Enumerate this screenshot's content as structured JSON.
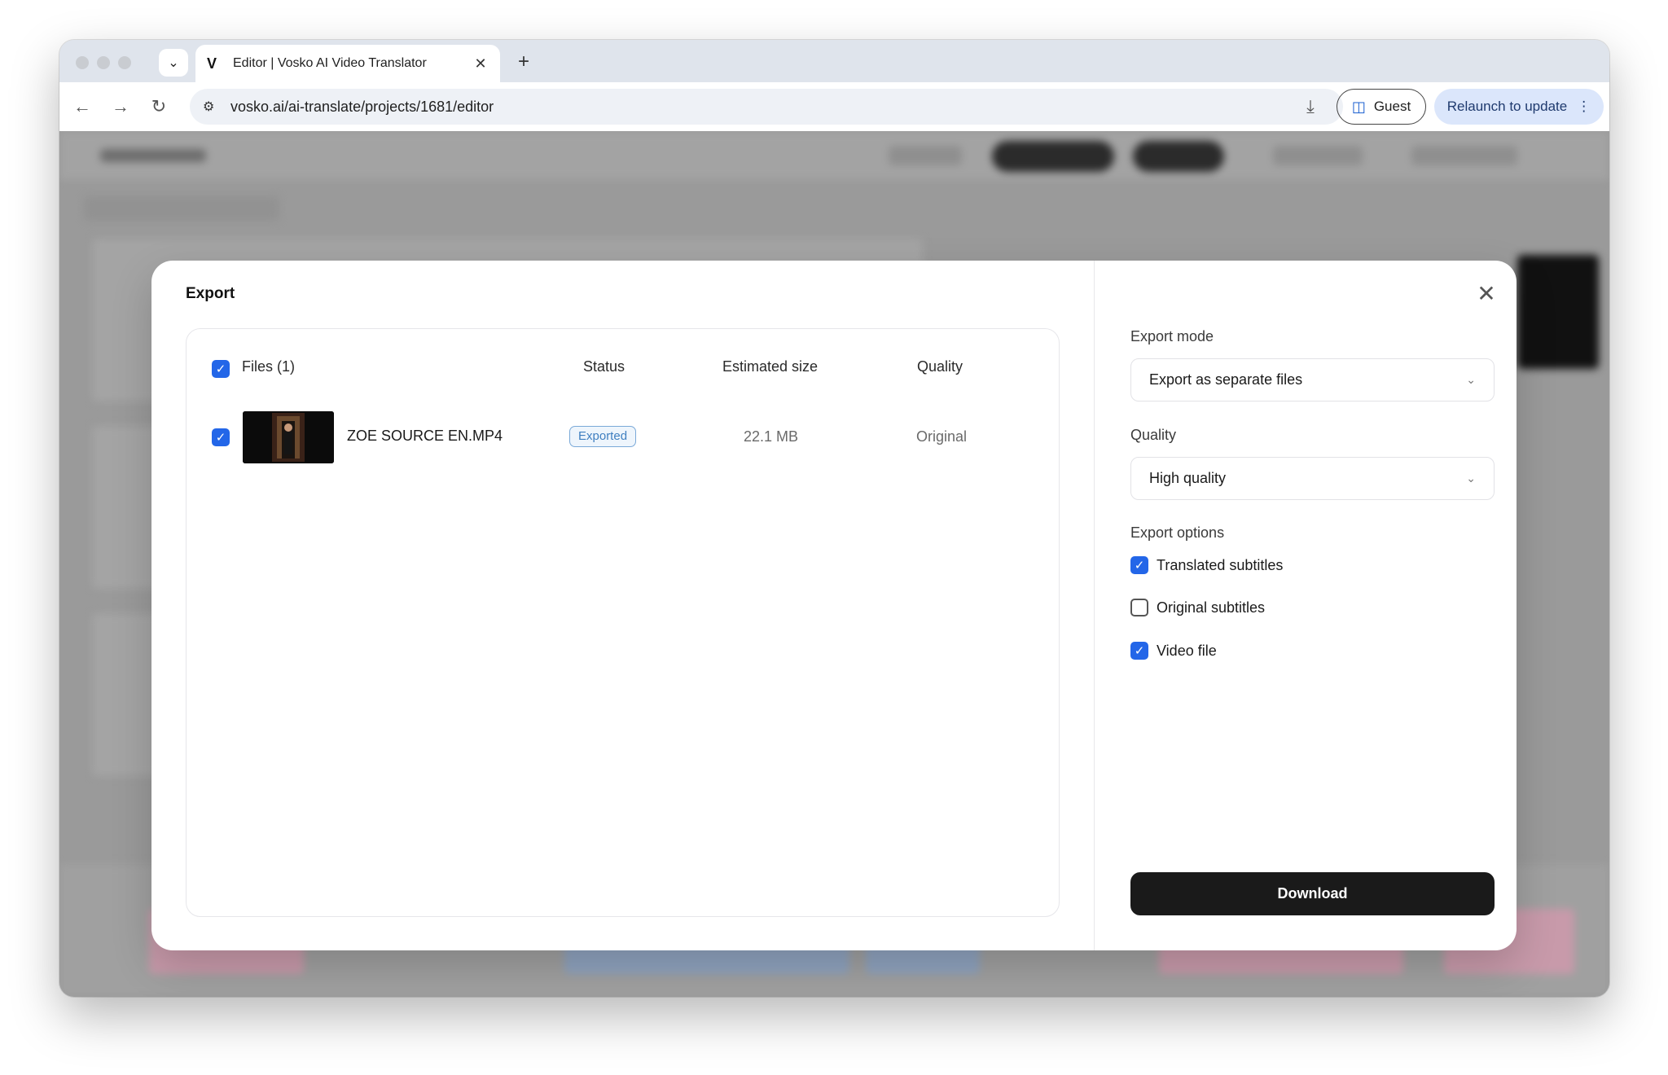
{
  "browser": {
    "tab_title": "Editor | Vosko AI Video Translator",
    "tab_logo": "V",
    "url": "vosko.ai/ai-translate/projects/1681/editor",
    "guest_label": "Guest",
    "relaunch_label": "Relaunch to update",
    "icons": {
      "back": "←",
      "forward": "→",
      "reload": "↻",
      "close_tab": "✕",
      "new_tab": "+",
      "dropdown": "⌄",
      "download": "⤓",
      "menu": "⋮",
      "site": "⚙",
      "guest": "◫"
    }
  },
  "modal": {
    "title": "Export",
    "close_icon": "✕",
    "files": {
      "header_files": "Files (1)",
      "header_status": "Status",
      "header_size": "Estimated size",
      "header_quality": "Quality",
      "rows": [
        {
          "name": "ZOE SOURCE EN.MP4",
          "status": "Exported",
          "size": "22.1 MB",
          "quality": "Original",
          "checked": true
        }
      ]
    },
    "export_mode": {
      "label": "Export mode",
      "value": "Export as separate files"
    },
    "quality": {
      "label": "Quality",
      "value": "High quality"
    },
    "export_options": {
      "label": "Export options",
      "items": [
        {
          "label": "Translated subtitles",
          "checked": true
        },
        {
          "label": "Original subtitles",
          "checked": false
        },
        {
          "label": "Video file",
          "checked": true
        }
      ]
    },
    "download_label": "Download"
  },
  "colors": {
    "accent": "#2366e8",
    "primary_button": "#1a1a1a",
    "badge_border": "#7aa9d8",
    "badge_text": "#3f7fc0"
  }
}
